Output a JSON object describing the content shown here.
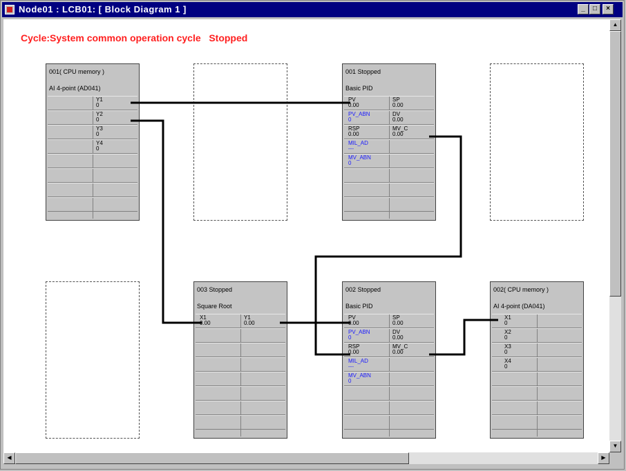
{
  "window": {
    "title": "Node01 : LCB01: [ Block Diagram 1 ]",
    "buttons": {
      "minimize": "_",
      "maximize": "□",
      "close": "×"
    }
  },
  "status": {
    "text": "Cycle:System common operation cycle   Stopped",
    "color": "#ff2020"
  },
  "blocks": {
    "b001cpu": {
      "header1": "001( CPU memory )",
      "header2": "AI 4-point (AD041)",
      "ports": [
        {
          "name": "Y1",
          "value": "0"
        },
        {
          "name": "Y2",
          "value": "0"
        },
        {
          "name": "Y3",
          "value": "0"
        },
        {
          "name": "Y4",
          "value": "0"
        }
      ]
    },
    "b001pid": {
      "header1": "001    Stopped",
      "header2": "Basic PID",
      "left": [
        {
          "name": "PV",
          "value": "0.00"
        },
        {
          "name": "PV_ABN",
          "value": "0"
        },
        {
          "name": "RSP",
          "value": "0.00"
        },
        {
          "name": "MIL_AD",
          "value": "---"
        },
        {
          "name": "MV_ABN",
          "value": "0"
        }
      ],
      "right": [
        {
          "name": "SP",
          "value": "0.00"
        },
        {
          "name": "DV",
          "value": "0.00"
        },
        {
          "name": "MV_C",
          "value": "0.00"
        }
      ]
    },
    "b003": {
      "header1": "003    Stopped",
      "header2": "Square Root",
      "left": [
        {
          "name": "X1",
          "value": "0.00"
        }
      ],
      "right": [
        {
          "name": "Y1",
          "value": "0.00"
        }
      ]
    },
    "b002pid": {
      "header1": "002    Stopped",
      "header2": "Basic PID",
      "left": [
        {
          "name": "PV",
          "value": "0.00"
        },
        {
          "name": "PV_ABN",
          "value": "0"
        },
        {
          "name": "RSP",
          "value": "0.00"
        },
        {
          "name": "MIL_AD",
          "value": "---"
        },
        {
          "name": "MV_ABN",
          "value": "0"
        }
      ],
      "right": [
        {
          "name": "SP",
          "value": "0.00"
        },
        {
          "name": "DV",
          "value": "0.00"
        },
        {
          "name": "MV_C",
          "value": "0.00"
        }
      ]
    },
    "b002cpu": {
      "header1": "002( CPU memory )",
      "header2": "AI 4-point (DA041)",
      "ports": [
        {
          "name": "X1",
          "value": "0"
        },
        {
          "name": "X2",
          "value": "0"
        },
        {
          "name": "X3",
          "value": "0"
        },
        {
          "name": "X4",
          "value": "0"
        }
      ]
    }
  },
  "colors": {
    "wire": "#000000",
    "block_bg": "#c4c4c4",
    "titlebar": "#000080"
  }
}
